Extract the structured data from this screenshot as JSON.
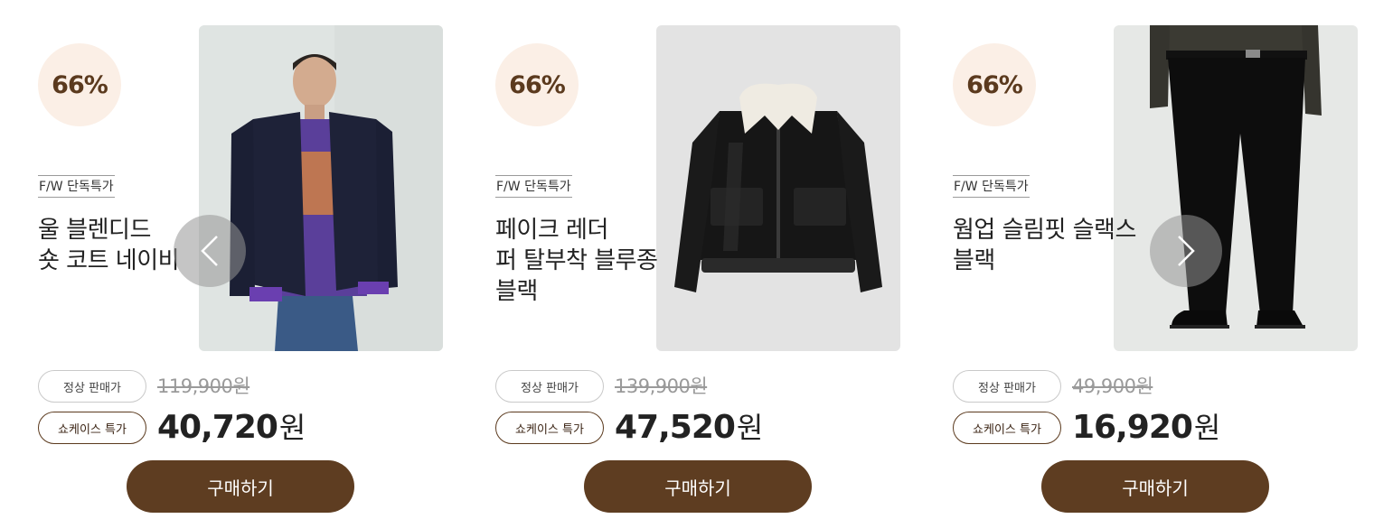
{
  "products": [
    {
      "discount": "66%",
      "tag": "F/W 단독특가",
      "title": "울 블렌디드\n숏 코트 네이비",
      "regular_label": "정상 판매가",
      "regular_price": "119,900원",
      "showcase_label": "쇼케이스 특가",
      "sale_price": "40,720",
      "currency": "원",
      "buy_label": "구매하기"
    },
    {
      "discount": "66%",
      "tag": "F/W 단독특가",
      "title": "페이크 레더\n퍼 탈부착 블루종\n블랙",
      "regular_label": "정상 판매가",
      "regular_price": "139,900원",
      "showcase_label": "쇼케이스 특가",
      "sale_price": "47,520",
      "currency": "원",
      "buy_label": "구매하기"
    },
    {
      "discount": "66%",
      "tag": "F/W 단독특가",
      "title": "웜업 슬림핏 슬랙스\n블랙",
      "regular_label": "정상 판매가",
      "regular_price": "49,900원",
      "showcase_label": "쇼케이스 특가",
      "sale_price": "16,920",
      "currency": "원",
      "buy_label": "구매하기"
    }
  ],
  "navigation": {
    "prev_icon": "chevron-left-icon",
    "next_icon": "chevron-right-icon"
  },
  "colors": {
    "accent": "#5e3d21",
    "badge_bg": "#fbefe6",
    "badge_text": "#5b3a1e"
  }
}
